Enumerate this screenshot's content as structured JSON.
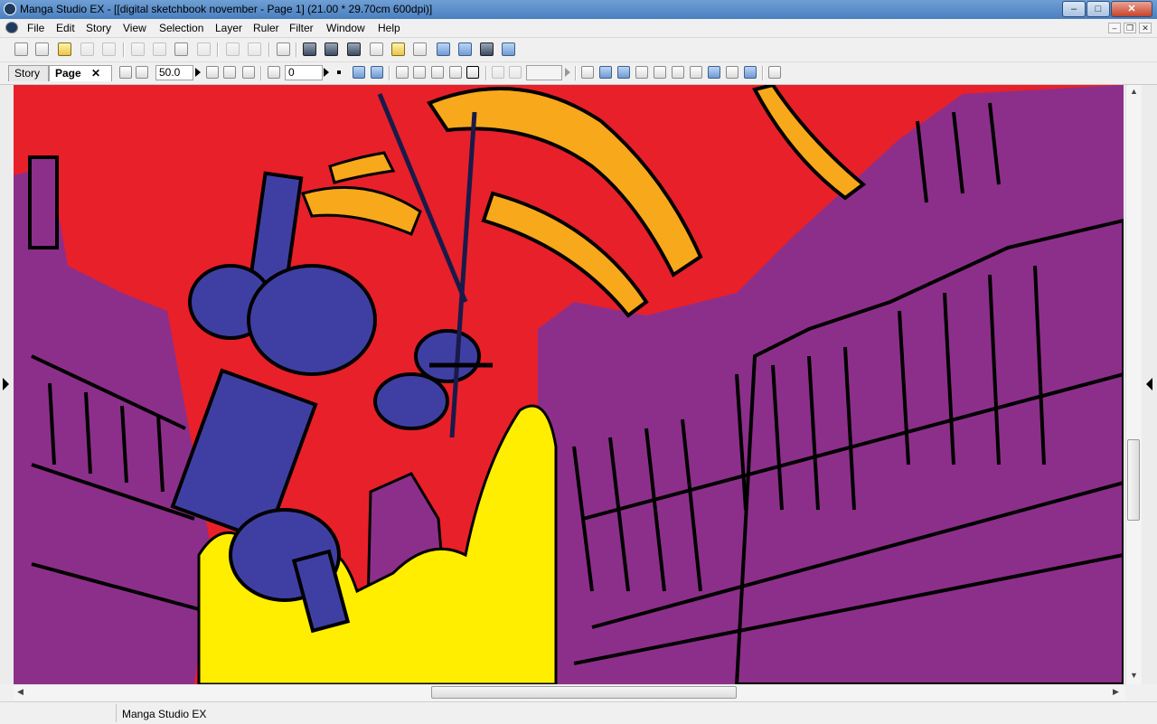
{
  "window": {
    "title": "Manga Studio EX - [[digital sketchbook november - Page 1] (21.00 * 29.70cm 600dpi)]",
    "controls": {
      "minimize": "–",
      "maximize": "□",
      "close": "✕"
    }
  },
  "menubar": {
    "items": [
      "File",
      "Edit",
      "Story",
      "View",
      "Selection",
      "Layer",
      "Ruler",
      "Filter",
      "Window",
      "Help"
    ],
    "mdi_controls": {
      "minimize": "–",
      "restore": "❐",
      "close": "✕"
    }
  },
  "toolbar2": {
    "tabs": [
      {
        "label": "Story"
      },
      {
        "label": "Page",
        "close": "✕"
      }
    ],
    "zoom_value": "50.0",
    "rotation_value": "0"
  },
  "statusbar": {
    "text": "Manga Studio EX"
  },
  "colors": {
    "sky": "#e8202a",
    "buildings": "#8c2f8a",
    "explosion": "#ffee00",
    "tentacle": "#f7a81b",
    "robot": "#3f3fa3"
  },
  "icons": [
    "new-page-icon",
    "new-story-icon",
    "open-icon",
    "save-icon",
    "save-all-icon",
    "cut-icon",
    "copy-icon",
    "paste-icon",
    "delete-icon",
    "undo-icon",
    "redo-icon",
    "print-icon"
  ]
}
